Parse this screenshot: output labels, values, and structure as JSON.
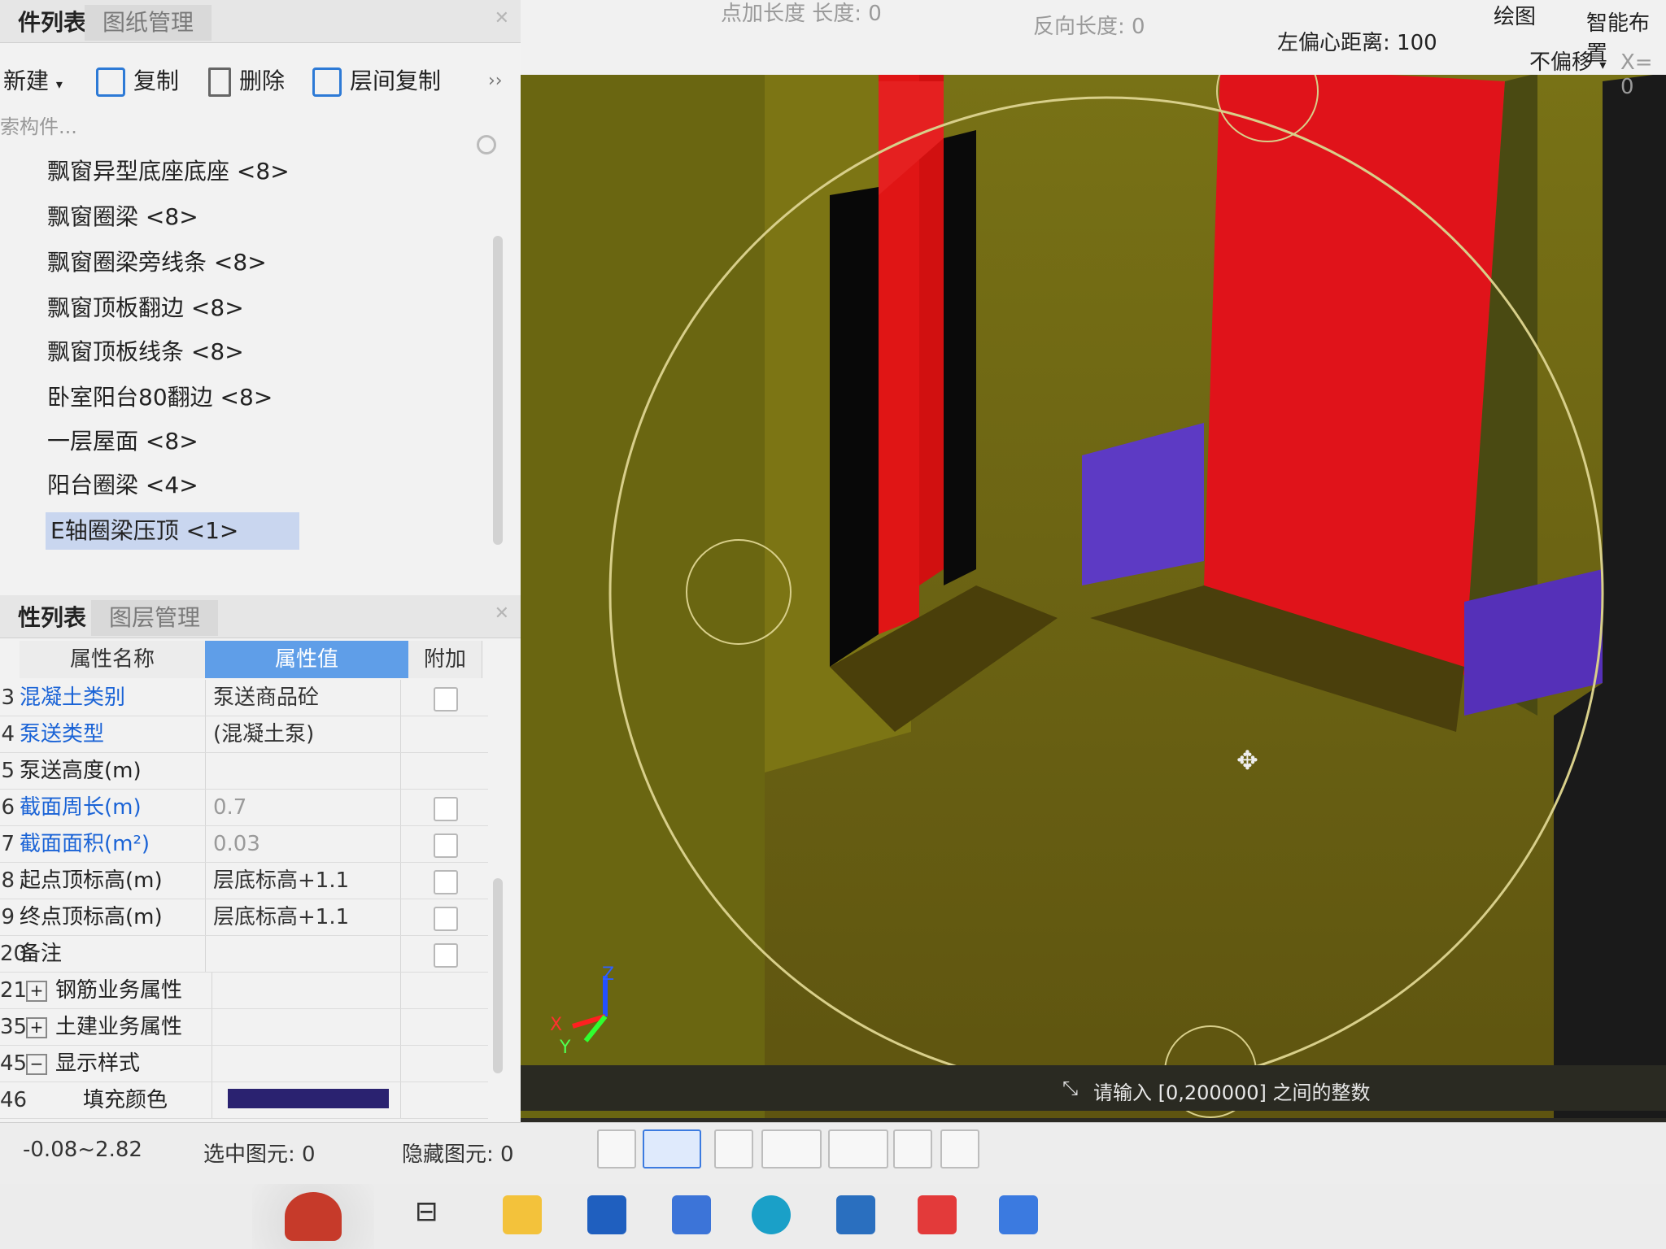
{
  "component_panel": {
    "tabs": [
      "件列表",
      "图纸管理"
    ],
    "toolbar": {
      "new": "新建",
      "copy": "复制",
      "delete": "删除",
      "floor_copy": "层间复制",
      "more": "››"
    },
    "search_placeholder": "索构件...",
    "items": [
      {
        "name": "飘窗异型底座底座",
        "count": "<8>"
      },
      {
        "name": "飘窗圈梁",
        "count": "<8>"
      },
      {
        "name": "飘窗圈梁旁线条",
        "count": "<8>"
      },
      {
        "name": "飘窗顶板翻边",
        "count": "<8>"
      },
      {
        "name": "飘窗顶板线条",
        "count": "<8>"
      },
      {
        "name": "卧室阳台80翻边",
        "count": "<8>"
      },
      {
        "name": "一层屋面",
        "count": "<8>"
      },
      {
        "name": "阳台圈梁",
        "count": "<4>"
      },
      {
        "name": "E轴圈梁压顶",
        "count": "<1>"
      }
    ]
  },
  "property_panel": {
    "tabs": [
      "性列表",
      "图层管理"
    ],
    "headers": {
      "name": "属性名称",
      "value": "属性值",
      "extra": "附加"
    },
    "rows": [
      {
        "num": "3",
        "name": "混凝土类别",
        "value": "泵送商品砼",
        "blue": true,
        "checkbox": true
      },
      {
        "num": "4",
        "name": "泵送类型",
        "value": "(混凝土泵)",
        "blue": true,
        "checkbox": false
      },
      {
        "num": "5",
        "name": "泵送高度(m)",
        "value": "",
        "blue": false,
        "checkbox": false
      },
      {
        "num": "6",
        "name": "截面周长(m)",
        "value": "0.7",
        "blue": true,
        "grey": true,
        "checkbox": true
      },
      {
        "num": "7",
        "name": "截面面积(m²)",
        "value": "0.03",
        "blue": true,
        "grey": true,
        "checkbox": true
      },
      {
        "num": "8",
        "name": "起点顶标高(m)",
        "value": "层底标高+1.1",
        "blue": false,
        "checkbox": true
      },
      {
        "num": "9",
        "name": "终点顶标高(m)",
        "value": "层底标高+1.1",
        "blue": false,
        "checkbox": true
      },
      {
        "num": "20",
        "name": "备注",
        "value": "",
        "blue": false,
        "checkbox": true
      },
      {
        "num": "21",
        "name": "钢筋业务属性",
        "value": "",
        "expand": "+"
      },
      {
        "num": "35",
        "name": "土建业务属性",
        "value": "",
        "expand": "+"
      },
      {
        "num": "45",
        "name": "显示样式",
        "value": "",
        "expand": "−"
      },
      {
        "num": "46",
        "name": "填充颜色",
        "value": "",
        "swatch": "#2a2270"
      }
    ]
  },
  "viewport": {
    "top_fields": {
      "add_length": "点加长度  长度: 0",
      "reverse_length": "反向长度: 0",
      "left_offset": "左偏心距离: 100",
      "draw": "绘图",
      "smart": "智能布置",
      "offset_mode": "不偏移",
      "x_coord": "X= 0"
    },
    "prompt": "请输入 [0,200000] 之间的整数",
    "axis": {
      "x": "X",
      "y": "Y",
      "z": "Z"
    }
  },
  "status_bar": {
    "elevation": "-0.08~2.82",
    "selected": "选中图元: 0",
    "hidden": "隐藏图元: 0"
  },
  "taskbar_apps": [
    "task-view",
    "file-explorer",
    "store",
    "baidu",
    "edge",
    "cad",
    "wps",
    "t-app"
  ]
}
